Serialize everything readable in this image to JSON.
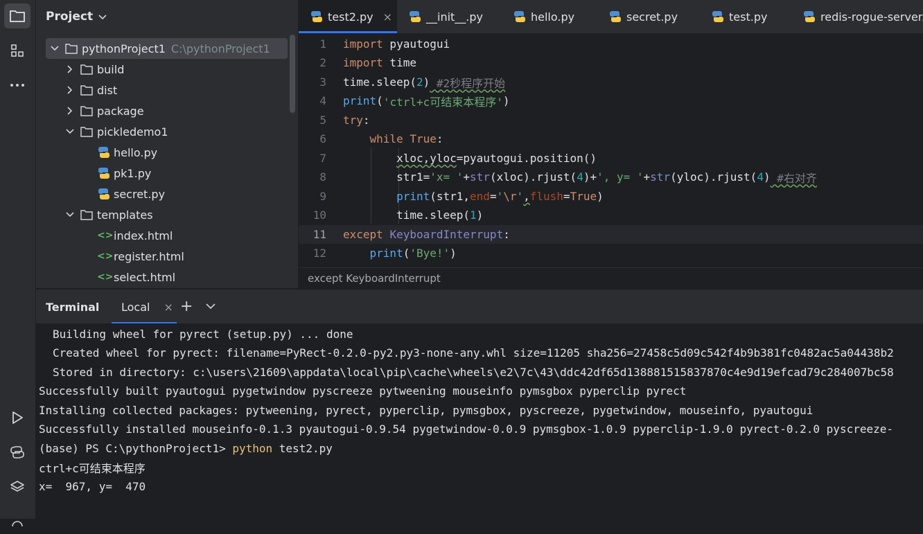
{
  "project_panel": {
    "title": "Project",
    "root": {
      "name": "pythonProject1",
      "path": "C:\\pythonProject1"
    },
    "items": [
      {
        "label": "build",
        "type": "folder",
        "expanded": false,
        "level": 1
      },
      {
        "label": "dist",
        "type": "folder",
        "expanded": false,
        "level": 1
      },
      {
        "label": "package",
        "type": "folder",
        "expanded": false,
        "level": 1
      },
      {
        "label": "pickledemo1",
        "type": "folder",
        "expanded": true,
        "level": 1
      },
      {
        "label": "hello.py",
        "type": "python",
        "level": 2
      },
      {
        "label": "pk1.py",
        "type": "python",
        "level": 2
      },
      {
        "label": "secret.py",
        "type": "python",
        "level": 2
      },
      {
        "label": "templates",
        "type": "folder",
        "expanded": true,
        "level": 1
      },
      {
        "label": "index.html",
        "type": "html",
        "level": 2
      },
      {
        "label": "register.html",
        "type": "html",
        "level": 2
      },
      {
        "label": "select.html",
        "type": "html",
        "level": 2
      }
    ]
  },
  "tabs": [
    {
      "label": "test2.py",
      "active": true
    },
    {
      "label": "__init__.py"
    },
    {
      "label": "hello.py"
    },
    {
      "label": "secret.py"
    },
    {
      "label": "test.py"
    },
    {
      "label": "redis-rogue-server."
    }
  ],
  "editor": {
    "current_line": 11,
    "line_numbers": [
      "1",
      "2",
      "3",
      "4",
      "5",
      "6",
      "7",
      "8",
      "9",
      "10",
      "11",
      "12"
    ],
    "code": {
      "l1_import": "import",
      "l1_mod": " pyautogui",
      "l2_import": "import",
      "l2_mod": " time",
      "l3_a": "time.sleep(",
      "l3_num": "2",
      "l3_b": ")",
      "l3_cmt": " #2秒程序开始",
      "l4_print": "print",
      "l4_a": "(",
      "l4_str": "'ctrl+c可结束本程序'",
      "l4_b": ")",
      "l5_try": "try",
      "l5_colon": ":",
      "l6_indent": "    ",
      "l6_while": "while",
      "l6_sp": " ",
      "l6_true": "True",
      "l6_colon": ":",
      "l7_indent": "        ",
      "l7_vars": "xloc,yloc",
      "l7_rest": "=pyautogui.position()",
      "l8_indent": "        ",
      "l8_a": "str1=",
      "l8_s1": "'x= '",
      "l8_b": "+",
      "l8_str1": "str",
      "l8_c": "(xloc).rjust(",
      "l8_n1": "4",
      "l8_d": ")+",
      "l8_s2": "', y= '",
      "l8_e": "+",
      "l8_str2": "str",
      "l8_f": "(yloc).rjust(",
      "l8_n2": "4",
      "l8_g": ")",
      "l8_cmt": " #右对齐",
      "l9_indent": "        ",
      "l9_print": "print",
      "l9_a": "(str1,",
      "l9_end": "end",
      "l9_eq": "=",
      "l9_s1": "'",
      "l9_esc": "\\r",
      "l9_s2": "'",
      "l9_comma": ",",
      "l9_flush": "flush",
      "l9_eq2": "=",
      "l9_true": "True",
      "l9_b": ")",
      "l10_indent": "        ",
      "l10_a": "time.sleep(",
      "l10_num": "1",
      "l10_b": ")",
      "l11_except": "except",
      "l11_sp": " ",
      "l11_cls": "KeyboardInterrupt",
      "l11_colon": ":",
      "l12_indent": "    ",
      "l12_print": "print",
      "l12_a": "(",
      "l12_str": "'Bye!'",
      "l12_b": ")"
    }
  },
  "breadcrumb": "except KeyboardInterrupt",
  "terminal": {
    "title": "Terminal",
    "tab_label": "Local",
    "lines": [
      "Building wheel for pyrect (setup.py) ... done",
      "Created wheel for pyrect: filename=PyRect-0.2.0-py2.py3-none-any.whl size=11205 sha256=27458c5d09c542f4b9b381fc0482ac5a04438b2",
      "Stored in directory: c:\\users\\21609\\appdata\\local\\pip\\cache\\wheels\\e2\\7c\\43\\ddc42df65d138881515837870c4e9d19efcad79c284007bc58",
      "Successfully built pyautogui pygetwindow pyscreeze pytweening mouseinfo pymsgbox pyperclip pyrect",
      "Installing collected packages: pytweening, pyrect, pyperclip, pymsgbox, pyscreeze, pygetwindow, mouseinfo, pyautogui",
      "Successfully installed mouseinfo-0.1.3 pyautogui-0.9.54 pygetwindow-0.0.9 pymsgbox-1.0.9 pyperclip-1.9.0 pyrect-0.2.0 pyscreeze-"
    ],
    "prompt": "(base) PS C:\\pythonProject1> ",
    "command": "python",
    "command_arg": " test2.py",
    "output1": "ctrl+c可结束本程序",
    "output2": "x=  967, y=  470"
  },
  "icons": {
    "toolstrip_top": [
      "folder-icon",
      "structure-icon",
      "more-icon"
    ],
    "toolstrip_bottom": [
      "run-icon",
      "python-console-icon",
      "layers-icon"
    ]
  }
}
